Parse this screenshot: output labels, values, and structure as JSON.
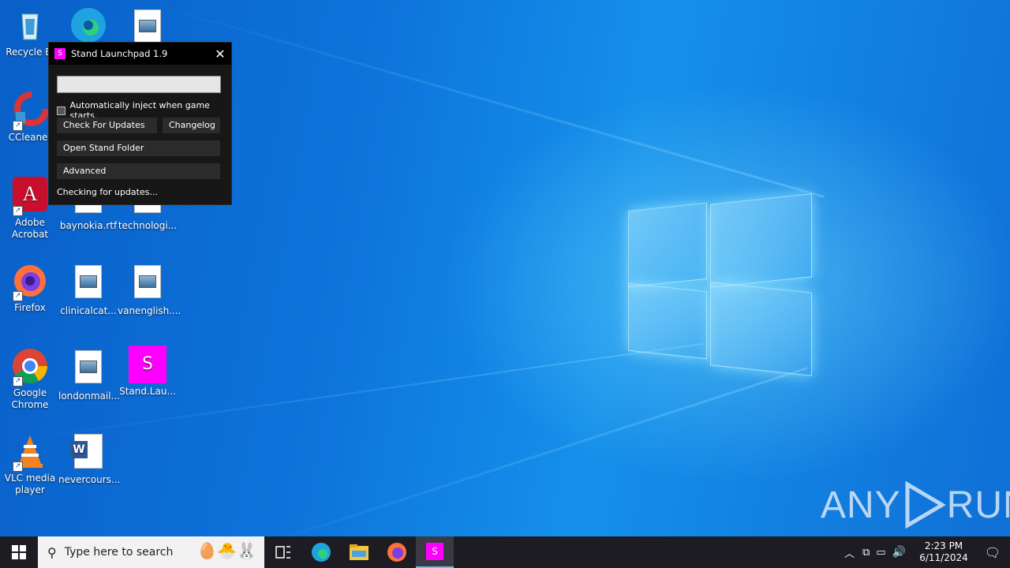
{
  "desktop": {
    "icons": [
      {
        "label": "Recycle Bi",
        "icon": "recycle-bin-icon"
      },
      {
        "label": "CCleaner",
        "icon": "ccleaner-icon"
      },
      {
        "label": "Adobe Acrobat",
        "icon": "adobe-acrobat-icon"
      },
      {
        "label": "Firefox",
        "icon": "firefox-icon"
      },
      {
        "label": "Google Chrome",
        "icon": "chrome-icon"
      },
      {
        "label": "VLC media player",
        "icon": "vlc-icon"
      },
      {
        "label": "baynokia.rtf",
        "icon": "document-icon"
      },
      {
        "label": "technologi...",
        "icon": "document-icon"
      },
      {
        "label": "clinicalcat...",
        "icon": "document-icon"
      },
      {
        "label": "vanenglish....",
        "icon": "document-icon"
      },
      {
        "label": "londonmail...",
        "icon": "document-icon"
      },
      {
        "label": "Stand.Lau...",
        "icon": "stand-icon"
      },
      {
        "label": "nevercours...",
        "icon": "word-icon"
      }
    ]
  },
  "launchpad": {
    "logo_letter": "S",
    "title": "Stand Launchpad 1.9",
    "input_value": "",
    "auto_inject_label": "Automatically inject when game starts.",
    "auto_inject_checked": false,
    "check_updates_label": "Check For Updates",
    "changelog_label": "Changelog",
    "open_folder_label": "Open Stand Folder",
    "advanced_label": "Advanced",
    "status": "Checking for updates...",
    "accent_color": "#ff00ff"
  },
  "watermark": {
    "left": "ANY",
    "right": "RUN"
  },
  "taskbar": {
    "search_placeholder": "Type here to search",
    "pinned": [
      "task-view-icon",
      "edge-icon",
      "file-explorer-icon",
      "firefox-icon",
      "stand-icon"
    ],
    "clock_time": "2:23 PM",
    "clock_date": "6/11/2024"
  },
  "colors": {
    "desktop_blue": "#0d74dc",
    "taskbar": "#1c1c22"
  }
}
